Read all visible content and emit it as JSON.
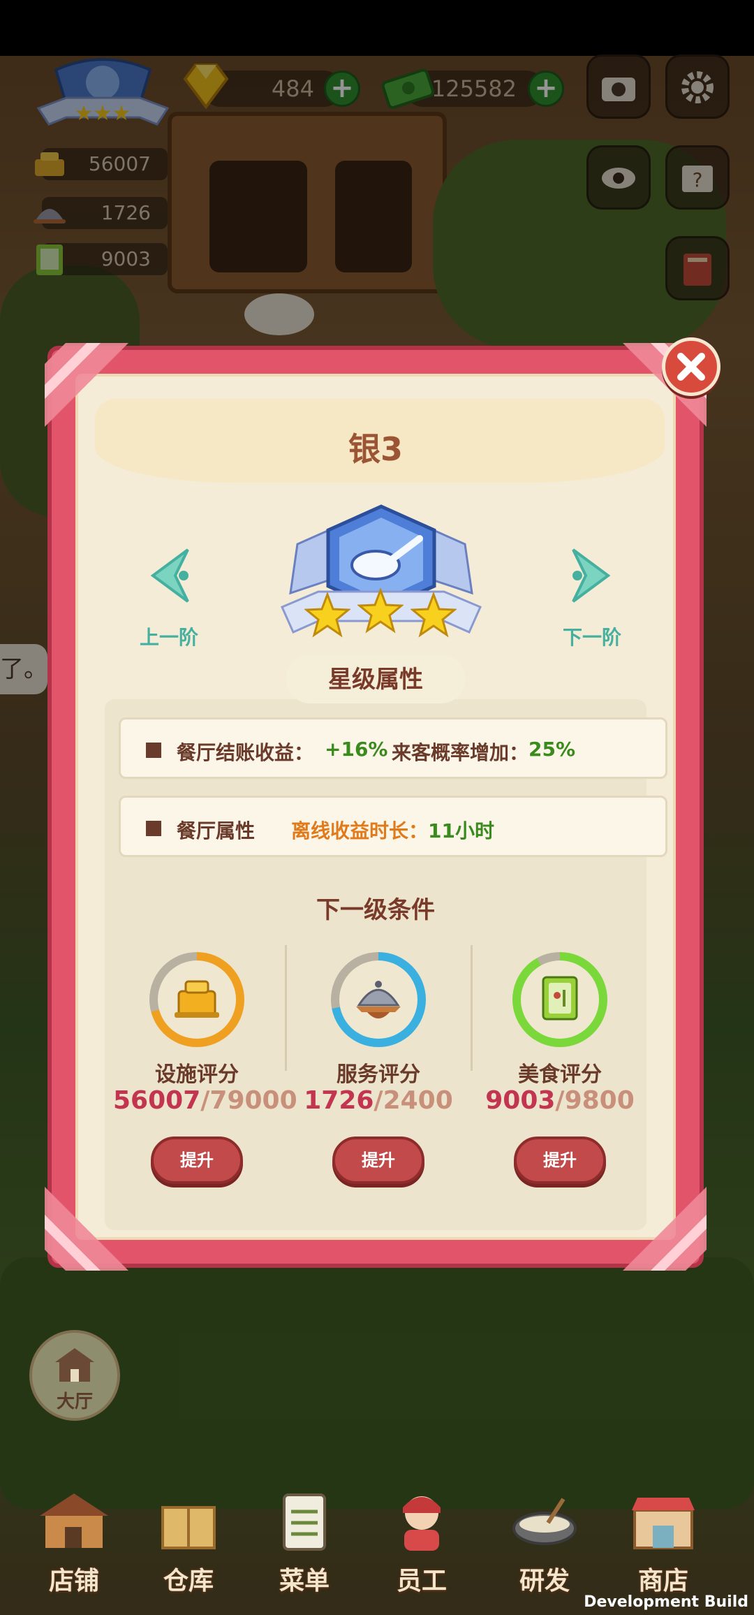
{
  "hud": {
    "gems": "484",
    "cash": "125582",
    "stat_facility": "56007",
    "stat_service": "1726",
    "stat_food": "9003"
  },
  "side_text": "了。",
  "modal": {
    "title": "银3",
    "prev_label": "上一阶",
    "next_label": "下一阶",
    "star_count": 3,
    "section_attrs": "星级属性",
    "attr_row1": {
      "label": "餐厅结账收益：",
      "value": "+16%",
      "label2": "来客概率增加：",
      "value2": "25%"
    },
    "attr_row2": {
      "label": "餐厅属性",
      "offline_label": "离线收益时长：",
      "offline_value": "11小时"
    },
    "section_next": "下一级条件",
    "requirements": [
      {
        "name": "设施评分",
        "current": "56007",
        "sep": "/",
        "target": "79000",
        "progress": 0.709,
        "color": "#f0a020",
        "button": "提升"
      },
      {
        "name": "服务评分",
        "current": "1726",
        "sep": "/",
        "target": "2400",
        "progress": 0.719,
        "color": "#3ab0e0",
        "button": "提升"
      },
      {
        "name": "美食评分",
        "current": "9003",
        "sep": "/",
        "target": "9800",
        "progress": 0.919,
        "color": "#7ad83a",
        "button": "提升"
      }
    ]
  },
  "hall_label": "大厅",
  "nav": [
    "店铺",
    "仓库",
    "菜单",
    "员工",
    "研发",
    "商店"
  ],
  "watermark": "Development Build",
  "colors": {
    "panel_border": "#e2546a",
    "panel_bg": "#f4ecd6",
    "accent_green": "#3a8a1e",
    "accent_orange": "#e07a1a"
  }
}
